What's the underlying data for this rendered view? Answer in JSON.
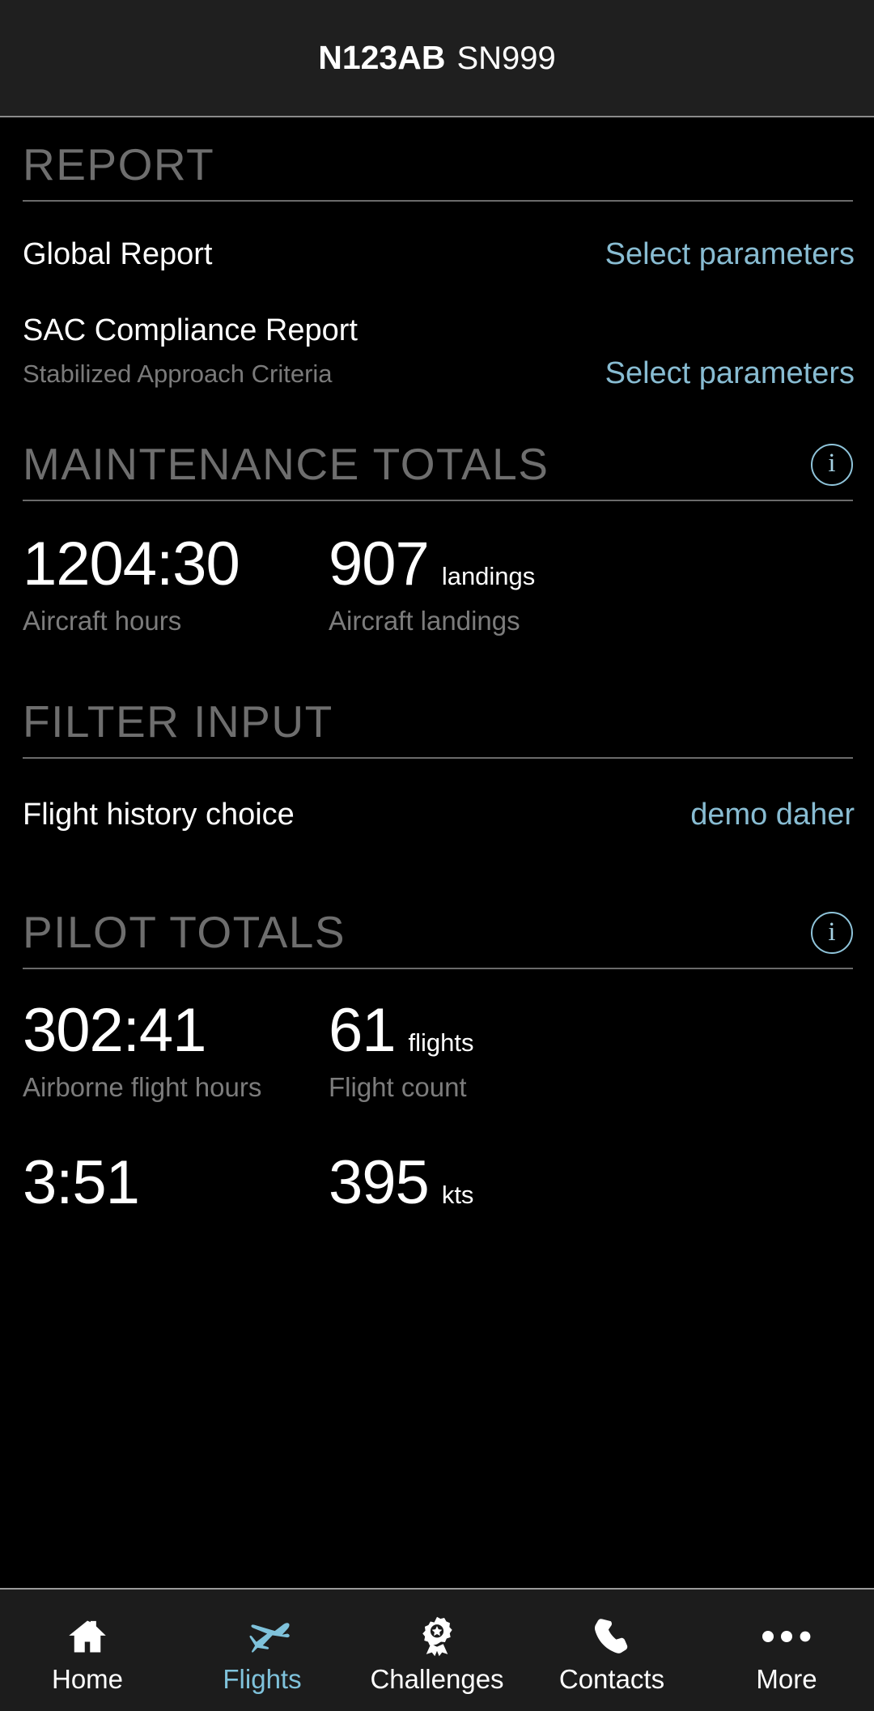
{
  "header": {
    "tail_number": "N123AB",
    "serial_number": "SN999"
  },
  "colors": {
    "accent_blue": "#88bcd2",
    "background": "#000000",
    "navbar": "#1f1f1f",
    "tabbar": "#1c1c1c",
    "section_title": "#6e6e6e",
    "caption_gray": "#7c7c7c"
  },
  "sections": {
    "report": {
      "title": "REPORT",
      "rows": [
        {
          "label": "Global Report",
          "subtitle": "",
          "action": "Select parameters"
        },
        {
          "label": "SAC Compliance Report",
          "subtitle": "Stabilized Approach Criteria",
          "action": "Select parameters"
        }
      ]
    },
    "maintenance_totals": {
      "title": "MAINTENANCE TOTALS",
      "info_icon": "info-icon",
      "stats": [
        {
          "value": "1204:30",
          "unit": "",
          "caption": "Aircraft hours"
        },
        {
          "value": "907",
          "unit": "landings",
          "caption": "Aircraft landings"
        }
      ]
    },
    "filter_input": {
      "title": "FILTER INPUT",
      "rows": [
        {
          "label": "Flight history choice",
          "value": "demo daher"
        }
      ]
    },
    "pilot_totals": {
      "title": "PILOT TOTALS",
      "info_icon": "info-icon",
      "stats_row1": [
        {
          "value": "302:41",
          "unit": "",
          "caption": "Airborne flight hours"
        },
        {
          "value": "61",
          "unit": "flights",
          "caption": "Flight count"
        }
      ],
      "stats_row2": [
        {
          "value": "3:51",
          "unit": ""
        },
        {
          "value": "395",
          "unit": "kts"
        }
      ]
    }
  },
  "tabbar": {
    "tabs": [
      {
        "label": "Home",
        "icon": "home-icon",
        "active": false
      },
      {
        "label": "Flights",
        "icon": "airplane-icon",
        "active": true
      },
      {
        "label": "Challenges",
        "icon": "award-ribbon-icon",
        "active": false
      },
      {
        "label": "Contacts",
        "icon": "phone-icon",
        "active": false
      },
      {
        "label": "More",
        "icon": "ellipsis-icon",
        "active": false
      }
    ]
  }
}
